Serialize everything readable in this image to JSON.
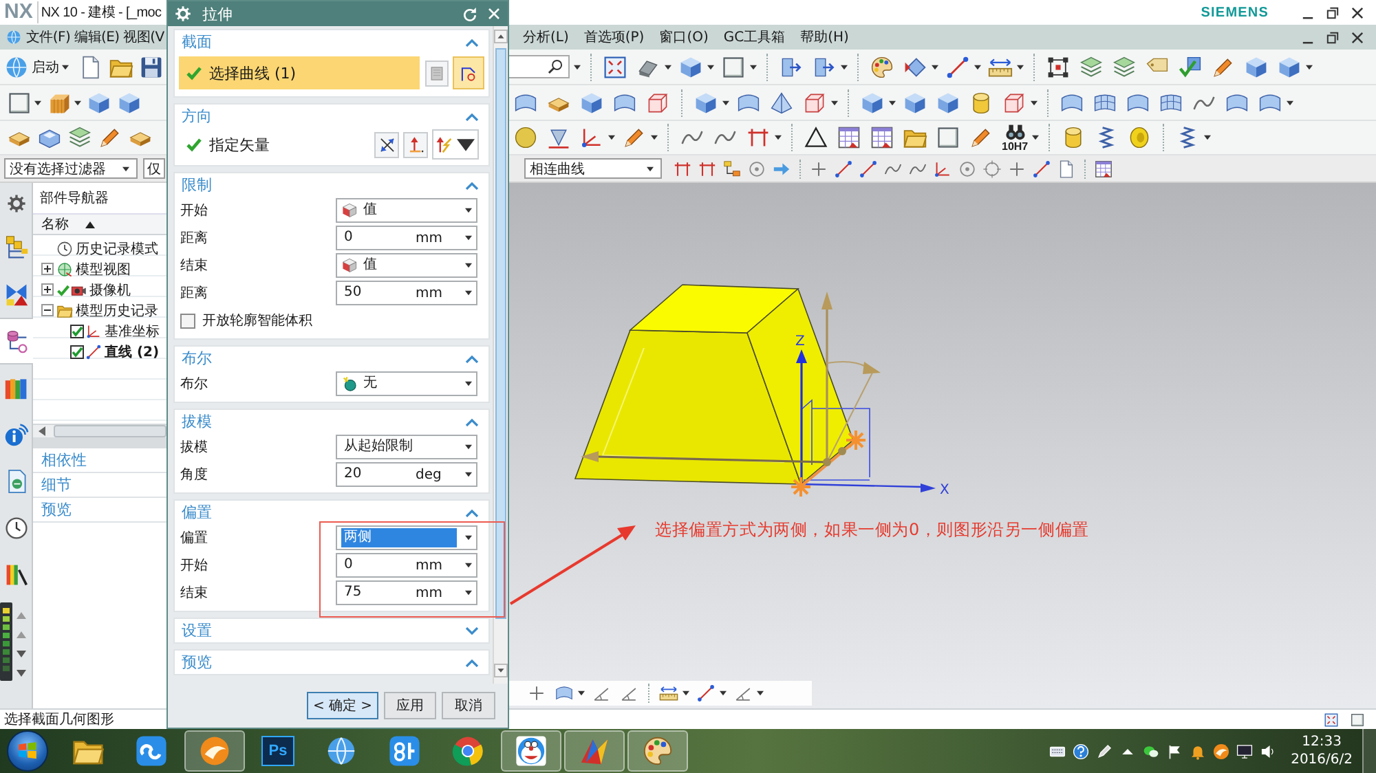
{
  "window": {
    "logo": "NX",
    "title": "NX 10 - 建模 - [_moc",
    "brand": "SIEMENS"
  },
  "menu": {
    "left": [
      "文件(F)",
      "编辑(E)",
      "视图(V"
    ],
    "right": [
      "分析(L)",
      "首选项(P)",
      "窗口(O)",
      "GC工具箱",
      "帮助(H)"
    ]
  },
  "toolbar": {
    "start_button": "启动",
    "tolerance_label": "10H7"
  },
  "selection_bar": {
    "type_filter": "没有选择过滤器",
    "scope_filter": "仅",
    "curve_rule": "相连曲线"
  },
  "resource_bar": {
    "tabs": [
      {
        "selected": false
      },
      {
        "selected": false
      },
      {
        "selected": true
      },
      {
        "selected": false
      },
      {
        "selected": false
      },
      {
        "selected": false
      },
      {
        "selected": false
      },
      {
        "selected": false
      }
    ]
  },
  "part_navigator": {
    "title": "部件导航器",
    "column": "名称",
    "tree": [
      {
        "kind": "mode",
        "label": "历史记录模式",
        "checked": false
      },
      {
        "kind": "views",
        "label": "模型视图",
        "expanded": false,
        "checked": false
      },
      {
        "kind": "cameras",
        "label": "摄像机",
        "expanded": false,
        "checked": true
      },
      {
        "kind": "history",
        "label": "模型历史记录",
        "expanded": true,
        "checked": false,
        "children": [
          {
            "kind": "csys",
            "label": "基准坐标",
            "checked": true,
            "current": false
          },
          {
            "kind": "line",
            "label": "直线 (2)",
            "checked": true,
            "current": true
          }
        ]
      }
    ],
    "panels": [
      "相依性",
      "细节",
      "预览"
    ]
  },
  "dialog": {
    "title": "拉伸",
    "groups": [
      {
        "title": "截面",
        "expanded": true,
        "outlined": false,
        "rows": [
          {
            "kind": "selection",
            "label": "选择曲线 (1)",
            "done": true,
            "active": true
          }
        ]
      },
      {
        "title": "方向",
        "expanded": true,
        "outlined": false,
        "rows": [
          {
            "kind": "vector",
            "label": "指定矢量",
            "done": true
          }
        ]
      },
      {
        "title": "限制",
        "expanded": true,
        "outlined": false,
        "rows": [
          {
            "kind": "limit",
            "label": "开始",
            "value": "值",
            "highlighted": false
          },
          {
            "kind": "number",
            "label": "距离",
            "value": "0",
            "unit": "mm",
            "highlighted": false
          },
          {
            "kind": "limit",
            "label": "结束",
            "value": "值",
            "highlighted": false
          },
          {
            "kind": "number",
            "label": "距离",
            "value": "50",
            "unit": "mm",
            "highlighted": false
          },
          {
            "kind": "checkbox",
            "label": "开放轮廓智能体积",
            "checked": false
          }
        ]
      },
      {
        "title": "布尔",
        "expanded": true,
        "outlined": false,
        "rows": [
          {
            "kind": "boolean",
            "label": "布尔",
            "value": "无",
            "highlighted": false
          }
        ]
      },
      {
        "title": "拔模",
        "expanded": true,
        "outlined": false,
        "rows": [
          {
            "kind": "choice",
            "label": "拔模",
            "value": "从起始限制",
            "highlighted": false
          },
          {
            "kind": "number",
            "label": "角度",
            "value": "20",
            "unit": "deg",
            "highlighted": false
          }
        ]
      },
      {
        "title": "偏置",
        "expanded": true,
        "outlined": true,
        "rows": [
          {
            "kind": "choice",
            "label": "偏置",
            "value": "两侧",
            "highlighted": true
          },
          {
            "kind": "number",
            "label": "开始",
            "value": "0",
            "unit": "mm",
            "highlighted": false
          },
          {
            "kind": "number",
            "label": "结束",
            "value": "75",
            "unit": "mm",
            "highlighted": false
          }
        ]
      },
      {
        "title": "设置",
        "expanded": false,
        "outlined": false
      },
      {
        "title": "预览",
        "expanded": true,
        "outlined": false
      }
    ],
    "buttons": [
      {
        "label": "< 确定 >",
        "default": true
      },
      {
        "label": "应用",
        "default": false
      },
      {
        "label": "取消",
        "default": false
      }
    ]
  },
  "graphics": {
    "axis_labels": {
      "z": "Z",
      "x": "X"
    },
    "annotation": "选择偏置方式为两侧，如果一侧为0，则图形沿另一侧偏置"
  },
  "status_bar": {
    "prompt": "选择截面几何图形"
  },
  "taskbar": {
    "apps": [
      {
        "kind": "folder",
        "open": false
      },
      {
        "kind": "loop",
        "open": false
      },
      {
        "kind": "ball",
        "open": true
      },
      {
        "kind": "texttile",
        "label": "Ps",
        "open": false
      },
      {
        "kind": "globe",
        "open": false
      },
      {
        "kind": "tile",
        "open": false
      },
      {
        "kind": "wheel",
        "open": false
      },
      {
        "kind": "cartoon",
        "open": true
      },
      {
        "kind": "arrows",
        "open": true
      },
      {
        "kind": "palette",
        "open": true
      }
    ],
    "clock": {
      "time": "12:33",
      "date": "2016/6/2"
    }
  }
}
